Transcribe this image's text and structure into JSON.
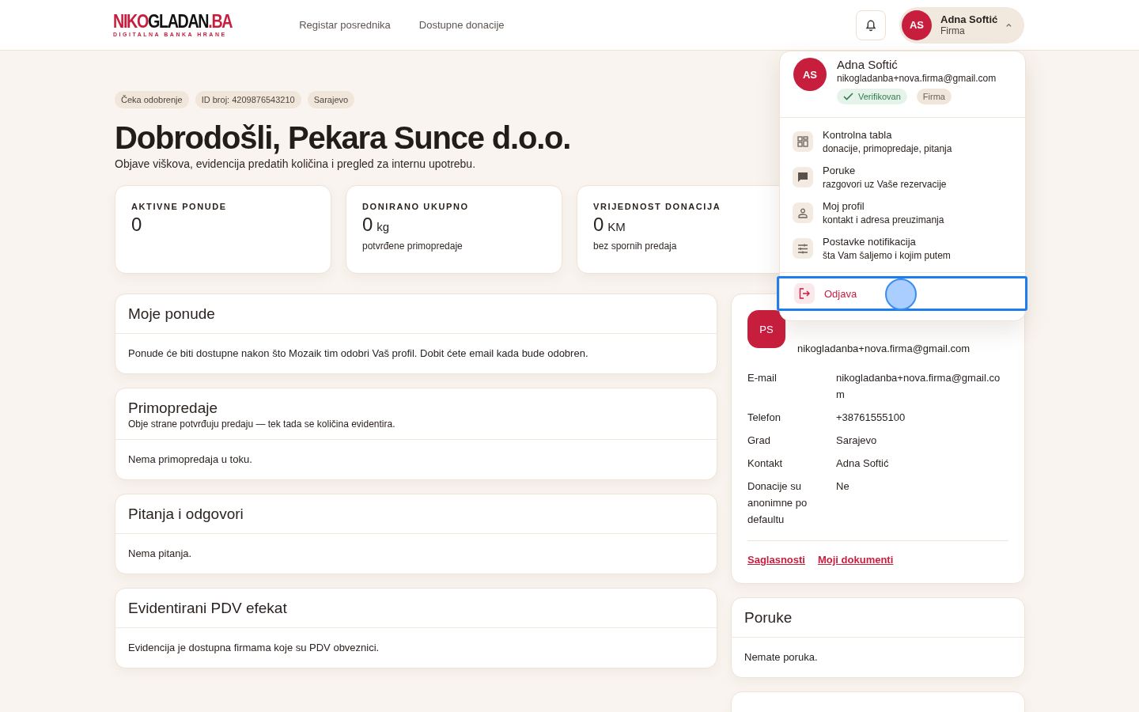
{
  "header": {
    "logo": {
      "parts": [
        {
          "text": "NIKO",
          "accent": true
        },
        {
          "text": "GLADAN",
          "accent": false
        },
        {
          "text": ".BA",
          "accent": true
        }
      ],
      "tagline": "DIGITALNA BANKA HRANE"
    },
    "nav": [
      "Registar posrednika",
      "Dostupne donacije"
    ],
    "user": {
      "initials": "AS",
      "name": "Adna Softić",
      "role": "Firma",
      "expanded": true
    }
  },
  "badges": [
    "Čeka odobrenje",
    "ID broj: 4209876543210",
    "Sarajevo"
  ],
  "title": "Dobrodošli, Pekara Sunce d.o.o.",
  "subtitle": "Objave viškova, evidencija predatih količina i pregled za internu upotrebu.",
  "stats": [
    {
      "label": "AKTIVNE PONUDE",
      "value": "0"
    },
    {
      "label": "DONIRANO UKUPNO",
      "value": "0",
      "unit": "kg",
      "note": "potvrđene primopredaje"
    },
    {
      "label": "VRIJEDNOST DONACIJA",
      "value": "0",
      "unit": "KM",
      "note": "bez spornih predaja"
    }
  ],
  "sections": [
    {
      "title": "Moje ponude",
      "body": "Ponude će biti dostupne nakon što Mozaik tim odobri Vaš profil. Dobit ćete email kada bude odobren."
    },
    {
      "title": "Primopredaje",
      "subtitle": "Obje strane potvrđuju predaju — tek tada se količina evidentira.",
      "body": "Nema primopredaja u toku."
    },
    {
      "title": "Pitanja i odgovori",
      "body": "Nema pitanja."
    },
    {
      "title": "Evidentirani PDV efekat",
      "body": "Evidencija je dostupna firmama koje su PDV obveznici."
    }
  ],
  "profile": {
    "initials": "PS",
    "email_top": "nikogladanba+nova.firma@gmail.com",
    "fields": [
      {
        "label": "E-mail",
        "value": "nikogladanba+nova.firma@gmail.com"
      },
      {
        "label": "Telefon",
        "value": "+38761555100"
      },
      {
        "label": "Grad",
        "value": "Sarajevo"
      },
      {
        "label": "Kontakt",
        "value": "Adna Softić"
      },
      {
        "label": "Donacije su anonimne po defaultu",
        "value": "Ne"
      }
    ],
    "links": [
      "Saglasnosti",
      "Moji dokumenti"
    ]
  },
  "messages": {
    "title": "Poruke",
    "body": "Nemate poruka."
  },
  "dropdown": {
    "initials": "AS",
    "name": "Adna Softić",
    "email": "nikogladanba+nova.firma@gmail.com",
    "tags": [
      {
        "kind": "verified",
        "text": "Verifikovan"
      },
      {
        "kind": "plain",
        "text": "Firma"
      }
    ],
    "items": [
      {
        "kind": "grid",
        "title": "Kontrolna tabla",
        "sub": "donacije, primopredaje, pitanja"
      },
      {
        "kind": "chat",
        "title": "Poruke",
        "sub": "razgovori uz Vaše rezervacije"
      },
      {
        "kind": "person",
        "title": "Moj profil",
        "sub": "kontakt i adresa preuzimanja"
      },
      {
        "kind": "sliders",
        "title": "Postavke notifikacija",
        "sub": "šta Vam šaljemo i kojim putem"
      }
    ],
    "logout": {
      "text": "Odjava",
      "focused": true
    }
  }
}
